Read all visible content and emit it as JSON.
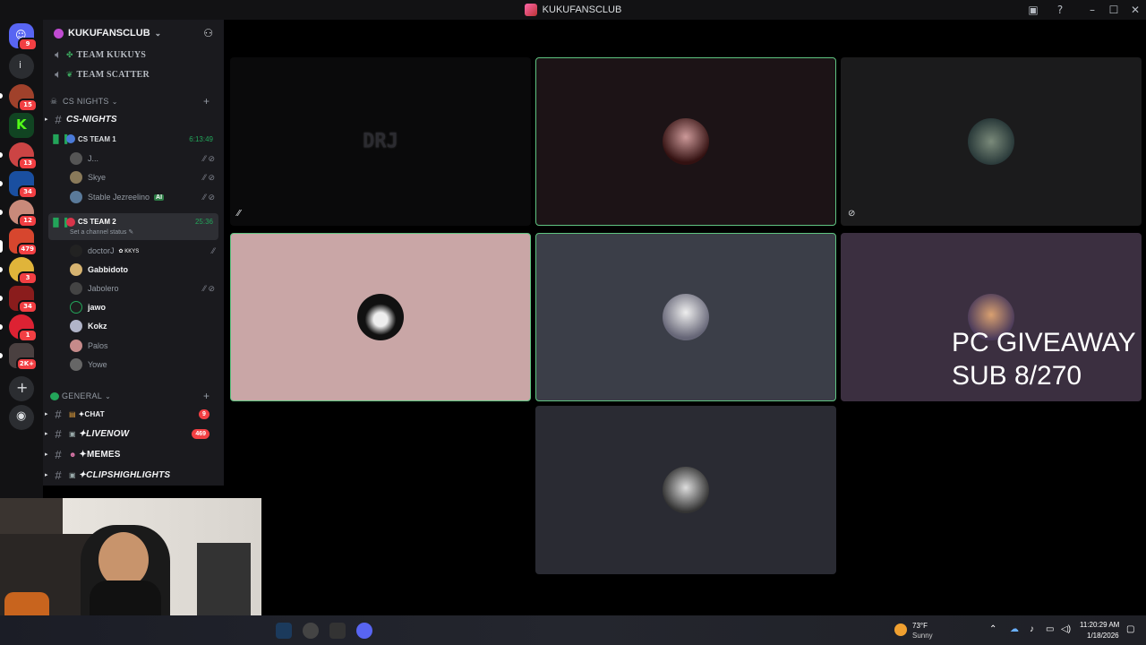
{
  "window": {
    "title": "KUKUFANSCLUB"
  },
  "rail": {
    "home_badge": "9",
    "server_badges": [
      "15",
      "13",
      "34",
      "12",
      "479",
      "3",
      "34",
      "1",
      "2K+"
    ],
    "letter_server": "i"
  },
  "guild": {
    "name": "KUKUFANSCLUB"
  },
  "sidebar": {
    "top_channels": [
      "TEAM KUKUYS",
      "TEAM SCATTER"
    ],
    "category_cs": "CS NIGHTS",
    "cs_nights_channel": "CS-NIGHTS",
    "voice1": {
      "name": "CS TEAM 1",
      "time": "6:13:49",
      "users": [
        "J...",
        "Skye",
        "Stable Jezreelino"
      ],
      "ai_tag": "AI"
    },
    "voice2": {
      "name": "CS TEAM 2",
      "time": "25:36",
      "status": "Set a channel status",
      "users": [
        "doctorJ",
        "Gabbidoto",
        "Jabolero",
        "jawo",
        "Kokz",
        "Palos",
        "Yowe"
      ],
      "tag": "KKYS"
    },
    "category_general": "GENERAL",
    "general_channels": [
      {
        "name": "✦CHAT",
        "badge": "9"
      },
      {
        "name": "✦LIVENOW",
        "badge": "469"
      },
      {
        "name": "✦MEMES",
        "badge": ""
      },
      {
        "name": "✦CLIPSHIGHLIGHTS",
        "badge": ""
      }
    ]
  },
  "stage": {
    "tile1_text": "DRJ",
    "overlay": "PC GIVEAWAY\nSUB 8/270"
  },
  "taskbar": {
    "weather_temp": "73°F",
    "weather_desc": "Sunny",
    "time": "11:20:29 AM",
    "date": "1/18/2026"
  },
  "colors": {
    "accent_green": "#23a55a",
    "mention_red": "#f23f43",
    "tile_border": "#5fc481"
  }
}
